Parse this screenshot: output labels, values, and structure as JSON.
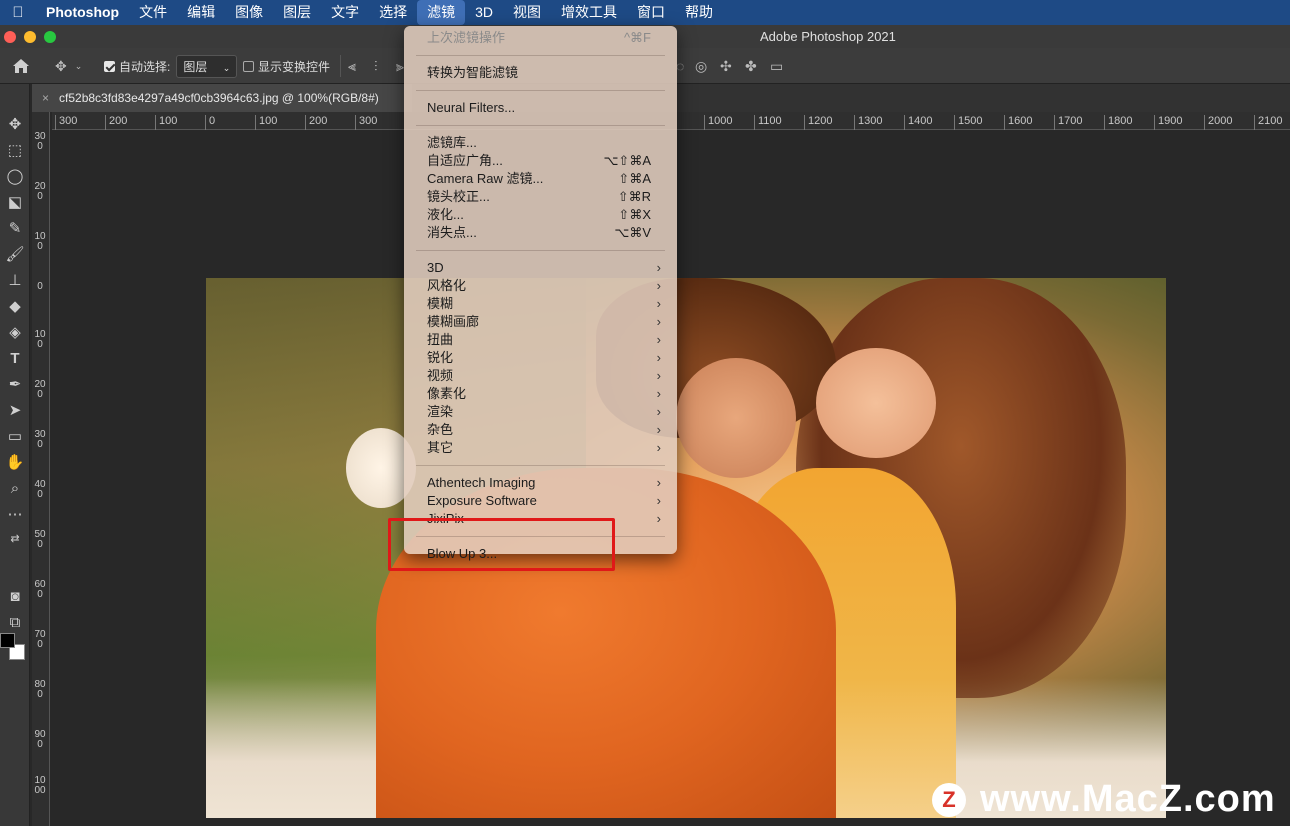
{
  "menubar": {
    "app": "Photoshop",
    "items": [
      "文件",
      "编辑",
      "图像",
      "图层",
      "文字",
      "选择",
      "滤镜",
      "3D",
      "视图",
      "增效工具",
      "窗口",
      "帮助"
    ],
    "active": "滤镜"
  },
  "window": {
    "title": "Adobe Photoshop 2021"
  },
  "options": {
    "auto_select_label": "自动选择:",
    "auto_select_value": "图层",
    "show_transform_label": "显示变换控件"
  },
  "document": {
    "tab_title": "cf52b8c3fd83e4297a49cf0cb3964c63.jpg @ 100%(RGB/8#)"
  },
  "ruler": {
    "h_left": [
      "300",
      "200",
      "100",
      "0",
      "100",
      "200",
      "300"
    ],
    "h_right": [
      "1000",
      "1100",
      "1200",
      "1300",
      "1400",
      "1500",
      "1600",
      "1700",
      "1800",
      "1900",
      "2000",
      "2100"
    ],
    "v": [
      "300",
      "200",
      "100",
      "0",
      "100",
      "200",
      "300",
      "400",
      "500",
      "600",
      "700",
      "800",
      "900",
      "1000"
    ]
  },
  "filter_menu": {
    "last_filter": {
      "label": "上次滤镜操作",
      "shortcut": "^⌘F"
    },
    "smart_filter": "转换为智能滤镜",
    "neural": "Neural Filters...",
    "group1": [
      {
        "label": "滤镜库...",
        "shortcut": ""
      },
      {
        "label": "自适应广角...",
        "shortcut": "⌥⇧⌘A"
      },
      {
        "label": "Camera Raw 滤镜...",
        "shortcut": "⇧⌘A"
      },
      {
        "label": "镜头校正...",
        "shortcut": "⇧⌘R"
      },
      {
        "label": "液化...",
        "shortcut": "⇧⌘X"
      },
      {
        "label": "消失点...",
        "shortcut": "⌥⌘V"
      }
    ],
    "submenus": [
      "3D",
      "风格化",
      "模糊",
      "模糊画廊",
      "扭曲",
      "锐化",
      "视频",
      "像素化",
      "渲染",
      "杂色",
      "其它"
    ],
    "plugins": [
      "Athentech Imaging",
      "Exposure Software",
      "JixiPix"
    ],
    "blowup": "Blow Up 3...",
    "arrow": "›"
  },
  "watermark": {
    "logo": "Z",
    "text": "www.MacZ.com"
  },
  "colors": {
    "menubar": "#1e4a85",
    "highlight": "#e01818"
  }
}
